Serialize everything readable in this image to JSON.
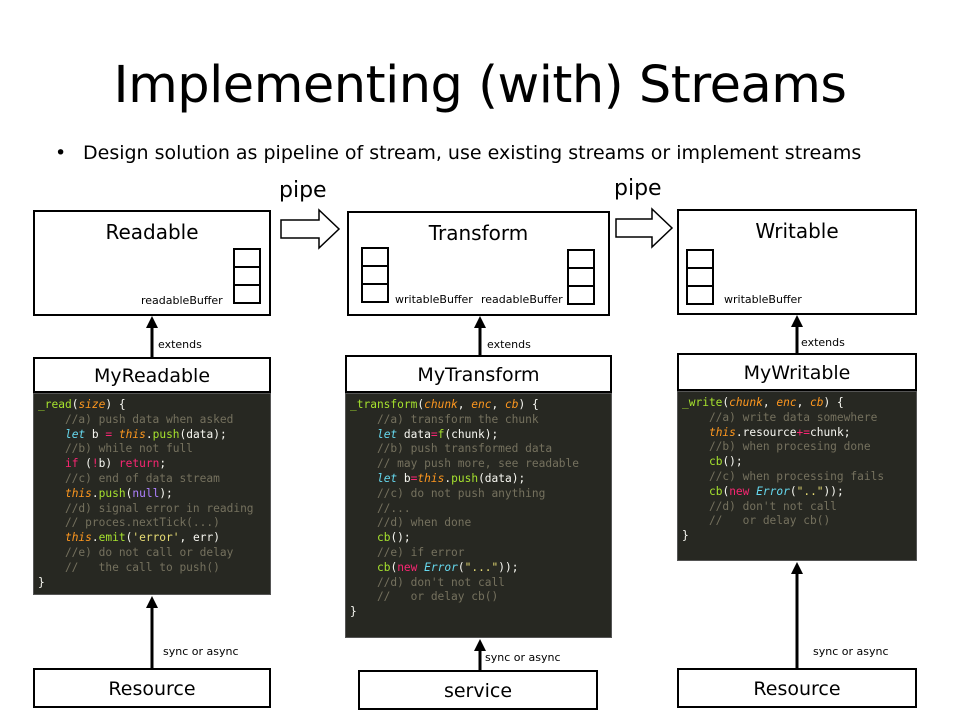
{
  "title": "Implementing (with) Streams",
  "bullet": "Design solution as pipeline of stream, use existing streams or implement streams",
  "pipe_labels": [
    "pipe",
    "pipe"
  ],
  "columns": {
    "readable": {
      "name": "Readable",
      "buffer_label": "readableBuffer",
      "extends_label": "extends",
      "impl_name": "MyReadable",
      "sync_label": "sync or async",
      "source_name": "Resource"
    },
    "transform": {
      "name": "Transform",
      "buffer_left_label": "writableBuffer",
      "buffer_right_label": "readableBuffer",
      "extends_label": "extends",
      "impl_name": "MyTransform",
      "sync_label": "sync or async",
      "source_name": "service"
    },
    "writable": {
      "name": "Writable",
      "buffer_label": "writableBuffer",
      "extends_label": "extends",
      "impl_name": "MyWritable",
      "sync_label": "sync or async",
      "source_name": "Resource"
    }
  },
  "code": {
    "readable": [
      [
        [
          "fn",
          "_read"
        ],
        [
          "yl",
          "("
        ],
        [
          "arg",
          "size"
        ],
        [
          "yl",
          ") {"
        ]
      ],
      [
        [
          "cm",
          "    //a) push data when asked"
        ]
      ],
      [
        [
          "yl",
          "    "
        ],
        [
          "cl",
          "let"
        ],
        [
          "yl",
          " b "
        ],
        [
          "kw",
          "="
        ],
        [
          "yl",
          " "
        ],
        [
          "th",
          "this"
        ],
        [
          "yl",
          "."
        ],
        [
          "fn",
          "push"
        ],
        [
          "yl",
          "(data);"
        ]
      ],
      [
        [
          "cm",
          "    //b) while not full"
        ]
      ],
      [
        [
          "yl",
          "    "
        ],
        [
          "kw",
          "if"
        ],
        [
          "yl",
          " ("
        ],
        [
          "kw",
          "!"
        ],
        [
          "yl",
          "b) "
        ],
        [
          "kw",
          "return"
        ],
        [
          "yl",
          ";"
        ]
      ],
      [
        [
          "cm",
          "    //c) end of data stream"
        ]
      ],
      [
        [
          "yl",
          "    "
        ],
        [
          "th",
          "this"
        ],
        [
          "yl",
          "."
        ],
        [
          "fn",
          "push"
        ],
        [
          "yl",
          "("
        ],
        [
          "num",
          "null"
        ],
        [
          "yl",
          ");"
        ]
      ],
      [
        [
          "cm",
          "    //d) signal error in reading"
        ]
      ],
      [
        [
          "cm",
          "    // proces.nextTick(...)"
        ]
      ],
      [
        [
          "yl",
          "    "
        ],
        [
          "th",
          "this"
        ],
        [
          "yl",
          "."
        ],
        [
          "fn",
          "emit"
        ],
        [
          "yl",
          "("
        ],
        [
          "st",
          "'error'"
        ],
        [
          "yl",
          ", err)"
        ]
      ],
      [
        [
          "cm",
          "    //e) do not call or delay"
        ]
      ],
      [
        [
          "cm",
          "    //   the call to push()"
        ]
      ],
      [
        [
          "yl",
          "}"
        ]
      ]
    ],
    "transform": [
      [
        [
          "fn",
          "_transform"
        ],
        [
          "yl",
          "("
        ],
        [
          "arg",
          "chunk"
        ],
        [
          "yl",
          ", "
        ],
        [
          "arg",
          "enc"
        ],
        [
          "yl",
          ", "
        ],
        [
          "arg",
          "cb"
        ],
        [
          "yl",
          ") {"
        ]
      ],
      [
        [
          "cm",
          "    //a) transform the chunk"
        ]
      ],
      [
        [
          "yl",
          "    "
        ],
        [
          "cl",
          "let"
        ],
        [
          "yl",
          " data"
        ],
        [
          "kw",
          "="
        ],
        [
          "fn",
          "f"
        ],
        [
          "yl",
          "(chunk);"
        ]
      ],
      [
        [
          "cm",
          "    //b) push transformed data"
        ]
      ],
      [
        [
          "cm",
          "    // may push more, see readable"
        ]
      ],
      [
        [
          "yl",
          "    "
        ],
        [
          "cl",
          "let"
        ],
        [
          "yl",
          " b"
        ],
        [
          "kw",
          "="
        ],
        [
          "th",
          "this"
        ],
        [
          "yl",
          "."
        ],
        [
          "fn",
          "push"
        ],
        [
          "yl",
          "(data);"
        ]
      ],
      [
        [
          "cm",
          "    //c) do not push anything"
        ]
      ],
      [
        [
          "cm",
          "    //..."
        ]
      ],
      [
        [
          "cm",
          "    //d) when done"
        ]
      ],
      [
        [
          "yl",
          "    "
        ],
        [
          "fn",
          "cb"
        ],
        [
          "yl",
          "();"
        ]
      ],
      [
        [
          "cm",
          "    //e) if error"
        ]
      ],
      [
        [
          "yl",
          "    "
        ],
        [
          "fn",
          "cb"
        ],
        [
          "yl",
          "("
        ],
        [
          "kw",
          "new"
        ],
        [
          "yl",
          " "
        ],
        [
          "cl",
          "Error"
        ],
        [
          "yl",
          "("
        ],
        [
          "st",
          "\"...\""
        ],
        [
          "yl",
          "));"
        ]
      ],
      [
        [
          "cm",
          "    //d) don't not call"
        ]
      ],
      [
        [
          "cm",
          "    //   or delay cb()"
        ]
      ],
      [
        [
          "yl",
          "}"
        ]
      ]
    ],
    "writable": [
      [
        [
          "fn",
          "_write"
        ],
        [
          "yl",
          "("
        ],
        [
          "arg",
          "chunk"
        ],
        [
          "yl",
          ", "
        ],
        [
          "arg",
          "enc"
        ],
        [
          "yl",
          ", "
        ],
        [
          "arg",
          "cb"
        ],
        [
          "yl",
          ") {"
        ]
      ],
      [
        [
          "cm",
          "    //a) write data somewhere"
        ]
      ],
      [
        [
          "yl",
          "    "
        ],
        [
          "th",
          "this"
        ],
        [
          "yl",
          ".resource"
        ],
        [
          "kw",
          "+="
        ],
        [
          "yl",
          "chunk;"
        ]
      ],
      [
        [
          "cm",
          "    //b) when procesing done"
        ]
      ],
      [
        [
          "yl",
          "    "
        ],
        [
          "fn",
          "cb"
        ],
        [
          "yl",
          "();"
        ]
      ],
      [
        [
          "cm",
          "    //c) when processing fails"
        ]
      ],
      [
        [
          "yl",
          "    "
        ],
        [
          "fn",
          "cb"
        ],
        [
          "yl",
          "("
        ],
        [
          "kw",
          "new"
        ],
        [
          "yl",
          " "
        ],
        [
          "cl",
          "Error"
        ],
        [
          "yl",
          "("
        ],
        [
          "st",
          "\"..\""
        ],
        [
          "yl",
          "));"
        ]
      ],
      [
        [
          "cm",
          "    //d) don't not call"
        ]
      ],
      [
        [
          "cm",
          "    //   or delay cb()"
        ]
      ],
      [
        [
          "yl",
          "}"
        ]
      ]
    ]
  }
}
